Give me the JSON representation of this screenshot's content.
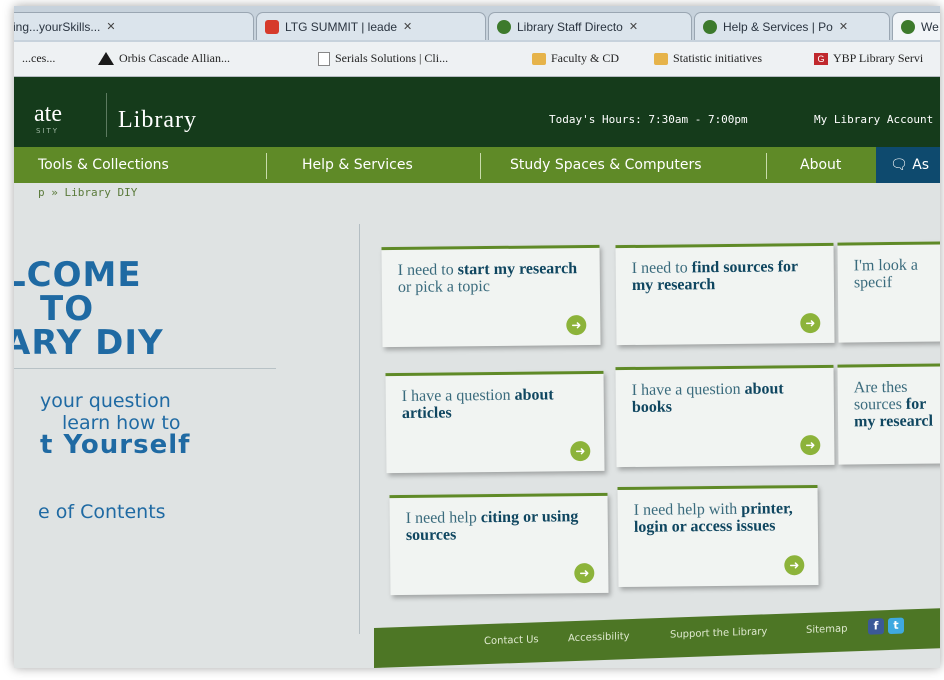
{
  "browser": {
    "tabs": [
      {
        "label": "...ing...yourSkills..."
      },
      {
        "label": "LTG SUMMIT | leade"
      },
      {
        "label": "Library Staff Directo"
      },
      {
        "label": "Help & Services | Po"
      },
      {
        "label": "We"
      }
    ],
    "bookmarks": [
      {
        "label": "...ces..."
      },
      {
        "label": "Orbis Cascade Allian..."
      },
      {
        "label": "Serials Solutions | Cli..."
      },
      {
        "label": "Faculty & CD"
      },
      {
        "label": "Statistic initiatives"
      },
      {
        "label": "YBP Library Servi"
      }
    ]
  },
  "header": {
    "logo_word": "ate",
    "logo_sub": "SITY",
    "site_name": "Library",
    "hours": "Today's Hours: 7:30am - 7:00pm",
    "account": "My Library Account"
  },
  "nav": {
    "items": [
      "Tools & Collections",
      "Help & Services",
      "Study Spaces & Computers",
      "About"
    ],
    "ask": "As"
  },
  "breadcrumb": "p » Library DIY",
  "welcome": {
    "line1": "LCOME",
    "line2": "TO",
    "line3": "ARY DIY",
    "intro1": "your question",
    "intro2": "learn how to",
    "intro3": "t Yourself",
    "toc": "e of Contents"
  },
  "cards": [
    {
      "pre": "I need to ",
      "hl": "start my research",
      "post": " or pick a topic"
    },
    {
      "pre": "I need to ",
      "hl": "find sources for my research",
      "post": ""
    },
    {
      "pre": "I'm look",
      "hl": "",
      "post": " a specif"
    },
    {
      "pre": "I have a question ",
      "hl": "about articles",
      "post": ""
    },
    {
      "pre": "I have a question ",
      "hl": "about books",
      "post": ""
    },
    {
      "pre": "Are thes sources ",
      "hl": "for my researcl",
      "post": ""
    },
    {
      "pre": "I need help ",
      "hl": "citing or using sources",
      "post": ""
    },
    {
      "pre": "I need help with ",
      "hl": "printer, login or access issues",
      "post": ""
    }
  ],
  "footer": {
    "links": [
      "Contact Us",
      "Accessibility",
      "Support the Library",
      "Sitemap"
    ],
    "facebook": "f",
    "twitter": "t"
  },
  "colors": {
    "header_green": "#153b1b",
    "nav_green": "#5f8a27",
    "accent_blue": "#1f6aa3",
    "ask_blue": "#0e4a6e"
  }
}
